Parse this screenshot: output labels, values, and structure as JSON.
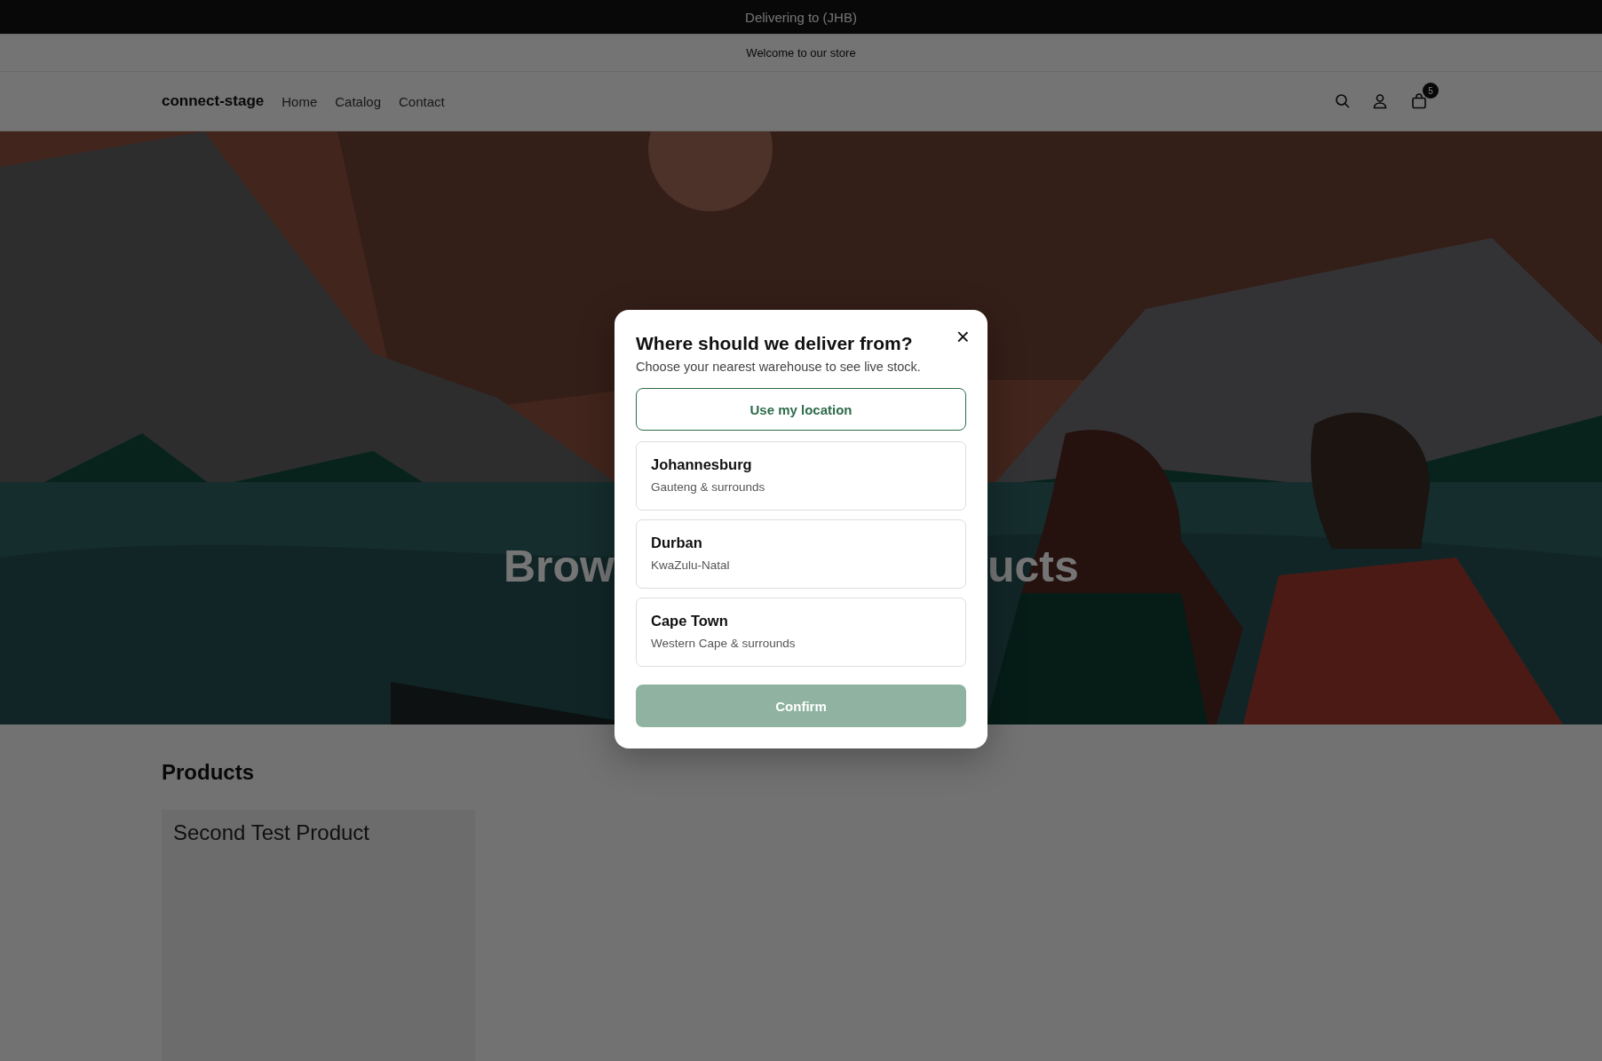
{
  "top_bar": {
    "text": "Delivering to (JHB)"
  },
  "announcement": {
    "text": "Welcome to our store"
  },
  "header": {
    "logo": "connect-stage",
    "nav": [
      {
        "label": "Home"
      },
      {
        "label": "Catalog"
      },
      {
        "label": "Contact"
      }
    ],
    "cart_count": "5"
  },
  "hero": {
    "kind": "picture",
    "title_parts": [
      "Brow",
      "ucts"
    ]
  },
  "products": {
    "heading": "Products",
    "cards": [
      {
        "title": "Second Test Product"
      }
    ]
  },
  "modal": {
    "title": "Where should we deliver from?",
    "subtitle": "Choose your nearest warehouse to see live stock.",
    "close": "×",
    "location_button": "Use my location",
    "options": [
      {
        "name": "Johannesburg",
        "region": "Gauteng & surrounds",
        "selected": false
      },
      {
        "name": "Durban",
        "region": "KwaZulu-Natal",
        "selected": false
      },
      {
        "name": "Cape Town",
        "region": "Western Cape & surrounds",
        "selected": false
      }
    ],
    "confirm": {
      "label": "Confirm",
      "disabled": true
    }
  }
}
